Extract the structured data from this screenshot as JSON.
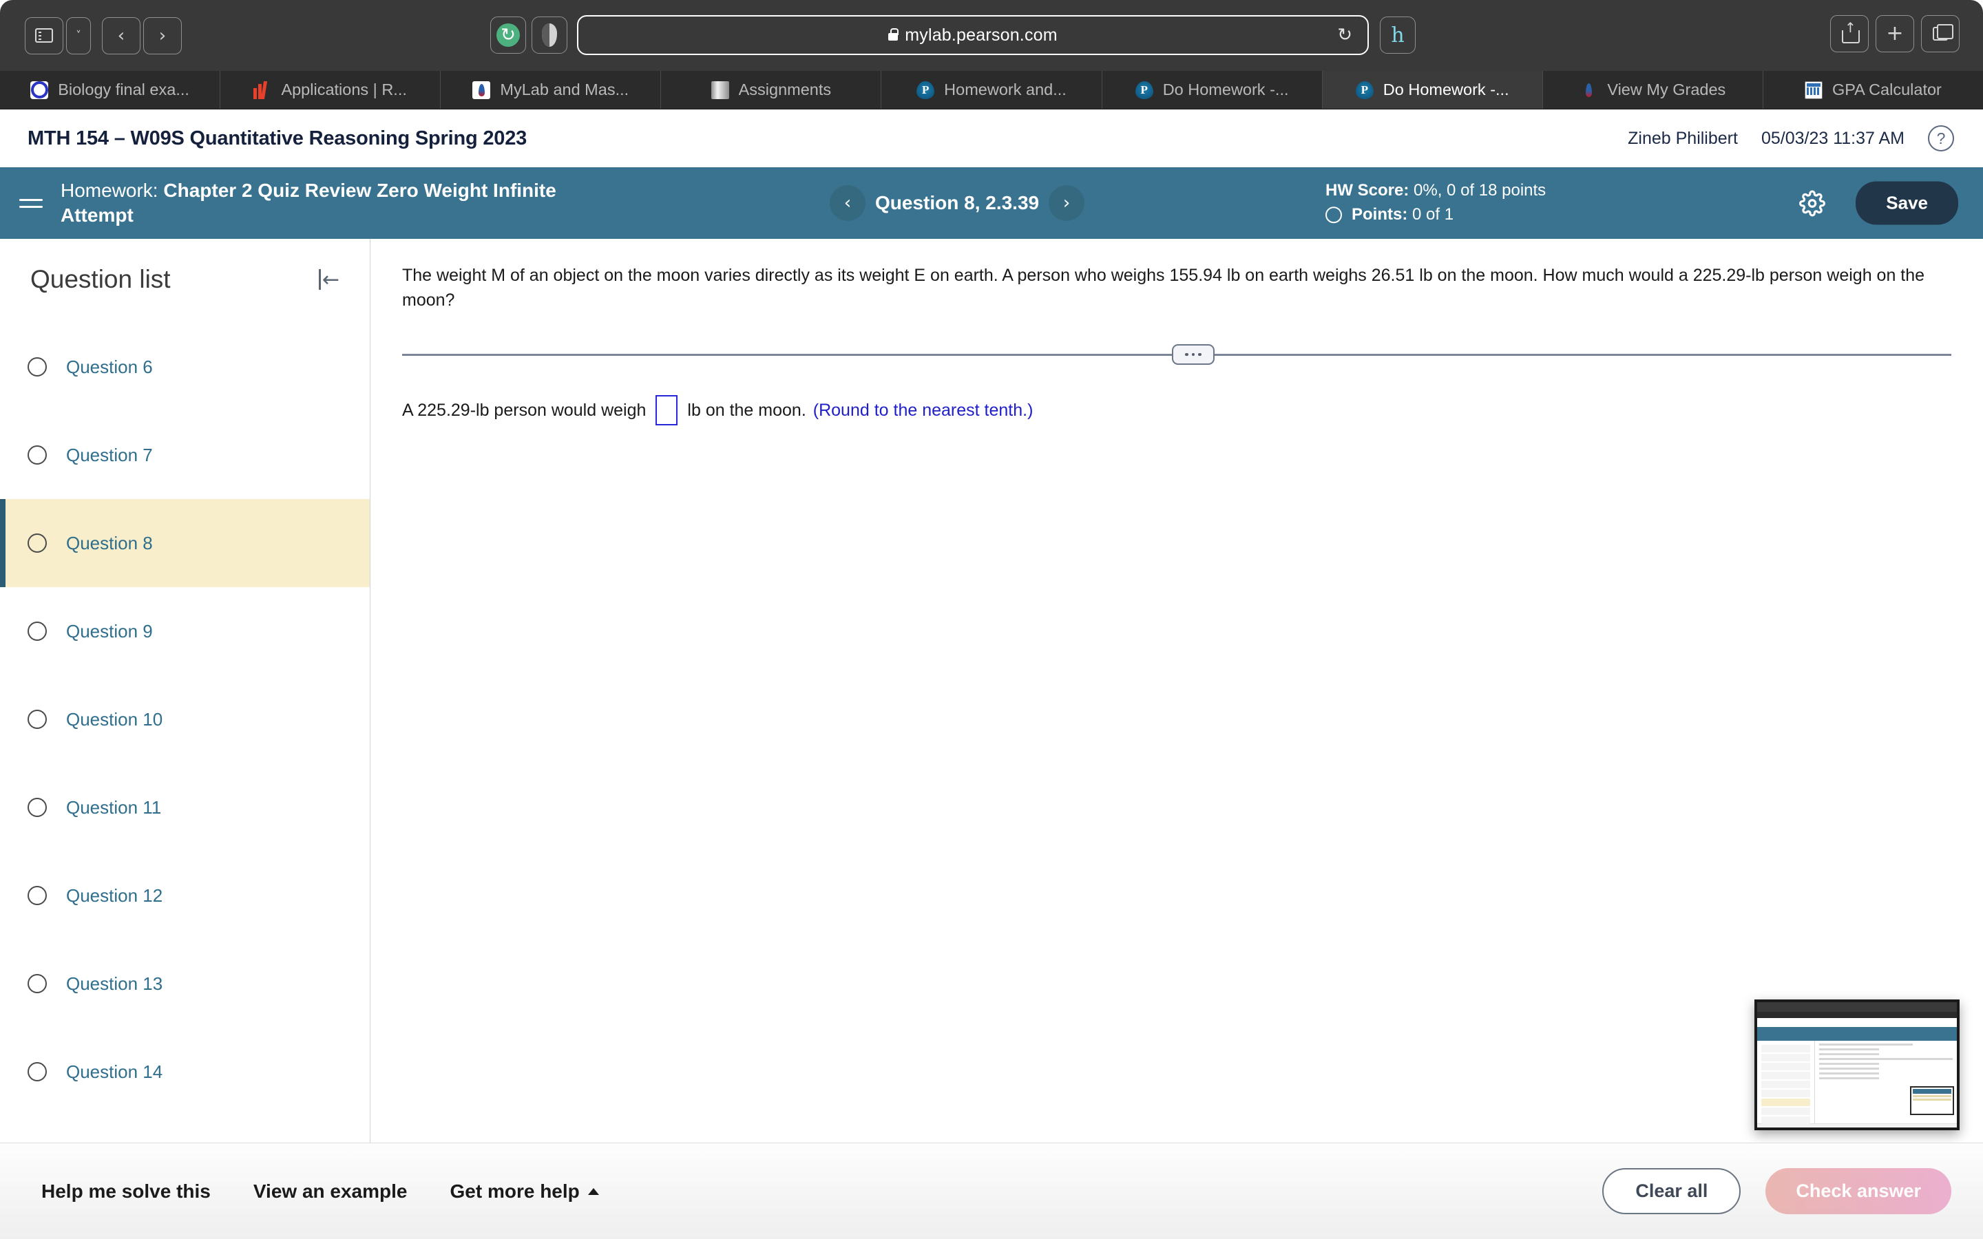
{
  "browser": {
    "url": "mylab.pearson.com",
    "lock_icon": "lock-icon",
    "reload_icon": "reload-icon",
    "back_icon": "back-arrow-icon",
    "forward_icon": "forward-arrow-icon",
    "sidebar_icon": "sidebar-toggle-icon",
    "share_icon": "share-icon",
    "newtab_icon": "plus-icon",
    "tabsoverview_icon": "tab-overview-icon",
    "extensions": [
      {
        "name": "grammarly-extension-icon"
      },
      {
        "name": "ghostery-extension-icon"
      },
      {
        "name": "hypothesis-extension-icon"
      }
    ],
    "tabs": [
      {
        "label": "Biology final exa...",
        "icon": "biology-favicon",
        "active": false
      },
      {
        "label": "Applications | R...",
        "icon": "applications-favicon",
        "active": false
      },
      {
        "label": "MyLab and Mas...",
        "icon": "mylab-favicon",
        "active": false
      },
      {
        "label": "Assignments",
        "icon": "assignments-favicon",
        "active": false
      },
      {
        "label": "Homework and...",
        "icon": "pearson-favicon",
        "active": false
      },
      {
        "label": "Do Homework -...",
        "icon": "pearson-favicon",
        "active": false
      },
      {
        "label": "Do Homework -...",
        "icon": "pearson-favicon",
        "active": true
      },
      {
        "label": "View My Grades",
        "icon": "grades-favicon",
        "active": false
      },
      {
        "label": "GPA Calculator",
        "icon": "calculator-favicon",
        "active": false
      }
    ]
  },
  "page_header": {
    "course_title": "MTH 154 – W09S Quantitative Reasoning Spring 2023",
    "user_name": "Zineb Philibert",
    "datetime": "05/03/23 11:37 AM",
    "help_icon": "question-mark-icon"
  },
  "homework_bar": {
    "menu_icon": "hamburger-menu-icon",
    "label": "Homework:",
    "assignment_name": "Chapter 2 Quiz Review Zero Weight Infinite Attempt",
    "prev_icon": "chevron-left-icon",
    "next_icon": "chevron-right-icon",
    "question_label": "Question 8, 2.3.39",
    "hw_score_label": "HW Score:",
    "hw_score_value": "0%, 0 of 18 points",
    "points_label": "Points:",
    "points_value": "0 of 1",
    "settings_icon": "gear-icon",
    "save_label": "Save",
    "bar_color": "#3a7390",
    "save_color": "#22364a"
  },
  "question_list": {
    "title": "Question list",
    "collapse_icon": "collapse-panel-icon",
    "items": [
      {
        "label": "Question 6",
        "current": false
      },
      {
        "label": "Question 7",
        "current": false
      },
      {
        "label": "Question 8",
        "current": true
      },
      {
        "label": "Question 9",
        "current": false
      },
      {
        "label": "Question 10",
        "current": false
      },
      {
        "label": "Question 11",
        "current": false
      },
      {
        "label": "Question 12",
        "current": false
      },
      {
        "label": "Question 13",
        "current": false
      },
      {
        "label": "Question 14",
        "current": false
      }
    ],
    "highlight_color": "#f8eecb",
    "link_color": "#2f6e8c"
  },
  "question": {
    "prompt": "The weight M of an object on the moon varies directly as its weight E on earth. A person who weighs 155.94 lb on earth weighs 26.51 lb on the moon. How much would a 225.29-lb person weigh on the moon?",
    "divider_handle_icon": "drag-handle-dots-icon",
    "answer_prefix": "A 225.29-lb person would weigh",
    "answer_value": "",
    "answer_suffix": "lb on the moon.",
    "rounding_note": "(Round to the nearest tenth.)",
    "note_color": "#1f1fc9"
  },
  "bottom_bar": {
    "help_solve": "Help me solve this",
    "view_example": "View an example",
    "get_more_help": "Get more help",
    "get_more_help_icon": "caret-up-icon",
    "clear_all": "Clear all",
    "check_answer": "Check answer"
  },
  "thumbnail": {
    "name": "screenshot-thumbnail-preview"
  }
}
